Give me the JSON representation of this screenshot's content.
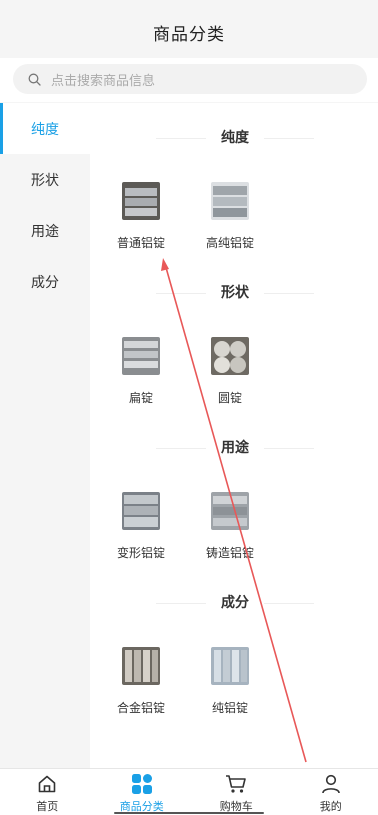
{
  "header": {
    "title": "商品分类"
  },
  "search": {
    "placeholder": "点击搜索商品信息",
    "icon": "search-icon"
  },
  "sidebar": {
    "items": [
      {
        "label": "纯度",
        "active": true
      },
      {
        "label": "形状",
        "active": false
      },
      {
        "label": "用途",
        "active": false
      },
      {
        "label": "成分",
        "active": false
      }
    ]
  },
  "sections": [
    {
      "title": "纯度",
      "products": [
        {
          "label": "普通铝锭"
        },
        {
          "label": "高纯铝锭"
        }
      ]
    },
    {
      "title": "形状",
      "products": [
        {
          "label": "扁锭"
        },
        {
          "label": "圆锭"
        }
      ]
    },
    {
      "title": "用途",
      "products": [
        {
          "label": "变形铝锭"
        },
        {
          "label": "铸造铝锭"
        }
      ]
    },
    {
      "title": "成分",
      "products": [
        {
          "label": "合金铝锭"
        },
        {
          "label": "纯铝锭"
        }
      ]
    }
  ],
  "tabbar": {
    "items": [
      {
        "label": "首页",
        "icon": "home-icon",
        "active": false
      },
      {
        "label": "商品分类",
        "icon": "category-grid-icon",
        "active": true
      },
      {
        "label": "购物车",
        "icon": "cart-icon",
        "active": false
      },
      {
        "label": "我的",
        "icon": "user-icon",
        "active": false
      }
    ]
  },
  "colors": {
    "accent": "#1aa0e6",
    "annotation_arrow": "#e85858"
  }
}
